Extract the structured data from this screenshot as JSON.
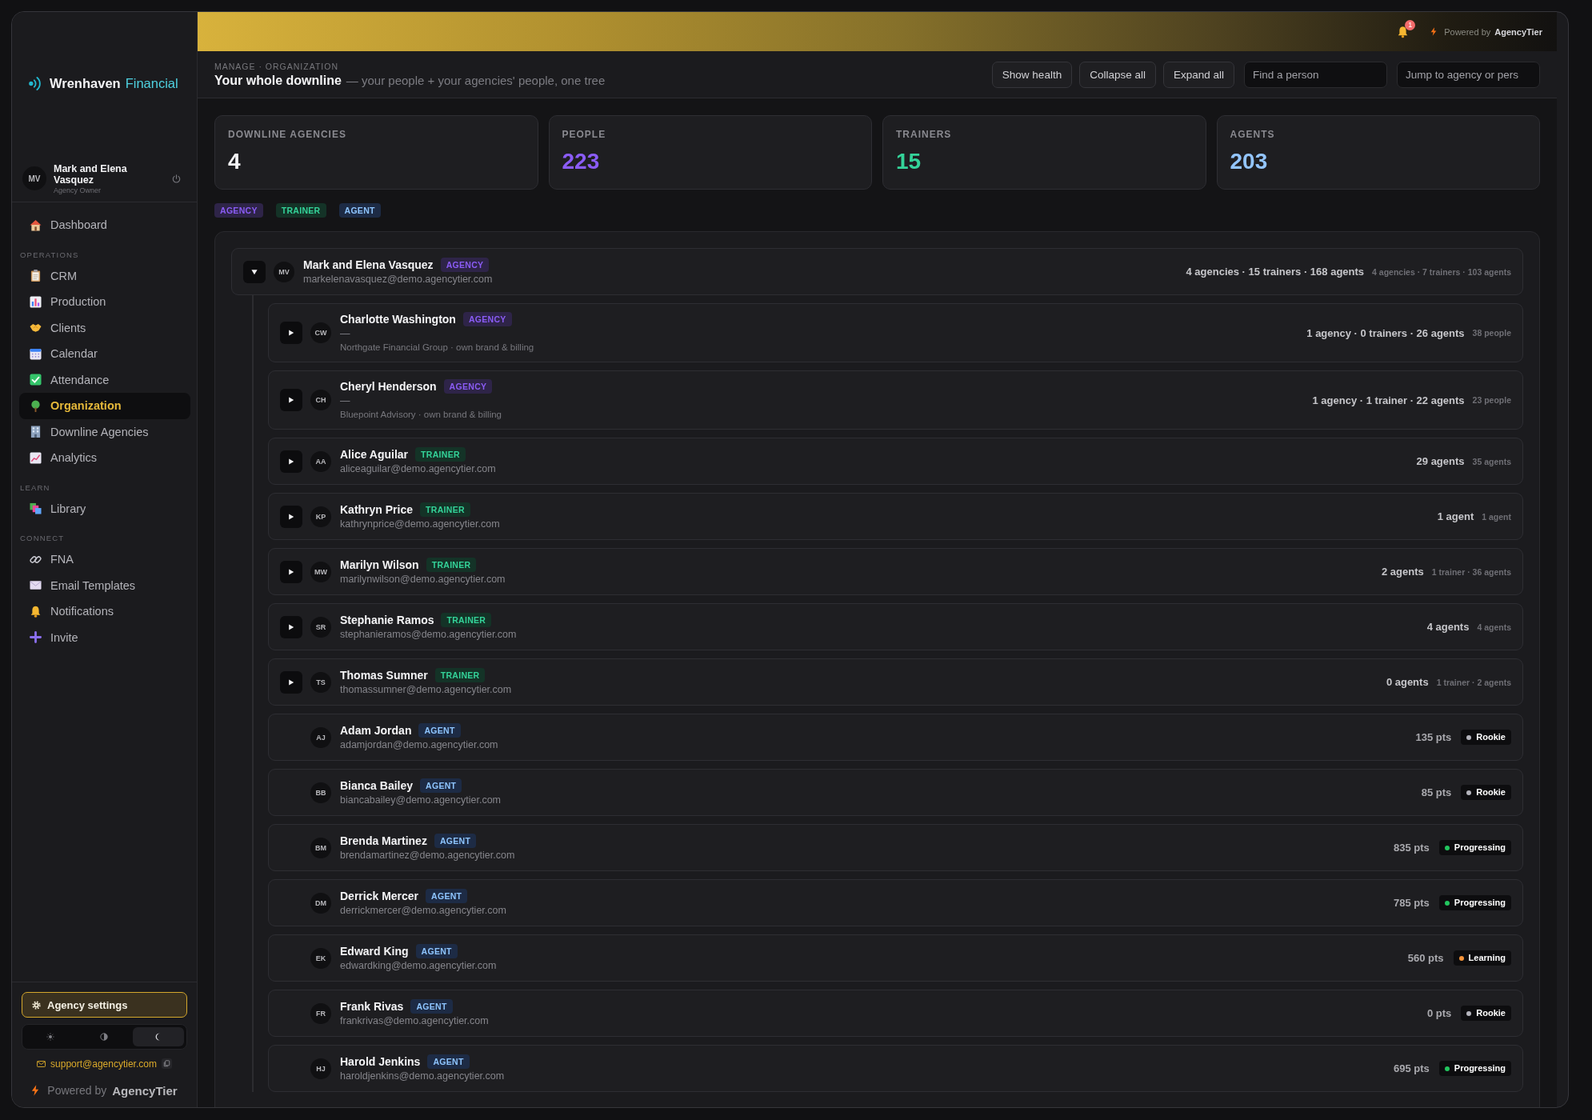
{
  "sidebar": {
    "brand": {
      "name": "Wrenhaven",
      "accent": "Financial"
    },
    "user": {
      "initials": "MV",
      "name": "Mark and Elena Vasquez",
      "role": "Agency Owner"
    },
    "nav_sections": [
      {
        "items": [
          {
            "label": "Dashboard",
            "selected": false
          }
        ]
      },
      {
        "heading": "OPERATIONS",
        "items": [
          {
            "label": "CRM",
            "selected": false
          },
          {
            "label": "Production",
            "selected": false
          },
          {
            "label": "Clients",
            "selected": false
          },
          {
            "label": "Calendar",
            "selected": false
          },
          {
            "label": "Attendance",
            "selected": false
          },
          {
            "label": "Organization",
            "selected": true
          },
          {
            "label": "Downline Agencies",
            "selected": false
          },
          {
            "label": "Analytics",
            "selected": false
          }
        ]
      },
      {
        "heading": "LEARN",
        "items": [
          {
            "label": "Library",
            "selected": false
          }
        ]
      },
      {
        "heading": "CONNECT",
        "items": [
          {
            "label": "FNA",
            "selected": false
          },
          {
            "label": "Email Templates",
            "selected": false
          },
          {
            "label": "Notifications",
            "selected": false
          },
          {
            "label": "Invite",
            "selected": false
          }
        ]
      }
    ],
    "settings_button": "Agency settings",
    "theme_options": [
      {
        "kind": "light",
        "selected": false
      },
      {
        "kind": "system",
        "selected": false
      },
      {
        "kind": "dark",
        "selected": true
      }
    ],
    "support_email": "support@agencytier.com",
    "powered_by": {
      "prefix": "Powered by",
      "brand": "AgencyTier"
    }
  },
  "top_bar": {
    "notification_count": "1",
    "powered_by": {
      "prefix": "Powered by",
      "brand": "AgencyTier"
    }
  },
  "header": {
    "breadcrumb": "MANAGE · ORGANIZATION",
    "title": "Your whole downline",
    "subtitle": "— your people + your agencies' people, one tree",
    "buttons": [
      "Show health",
      "Collapse all",
      "Expand all"
    ],
    "search_fields": [
      {
        "placeholder": "Find a person"
      },
      {
        "placeholder": "Jump to agency or pers"
      }
    ]
  },
  "stats": [
    {
      "label": "DOWNLINE AGENCIES",
      "value": "4",
      "color": "#f4f4f6"
    },
    {
      "label": "PEOPLE",
      "value": "223",
      "color": "#8b5cf6"
    },
    {
      "label": "TRAINERS",
      "value": "15",
      "color": "#34d399"
    },
    {
      "label": "AGENTS",
      "value": "203",
      "color": "#93c5fd"
    }
  ],
  "legend": [
    {
      "label": "AGENCY",
      "kind": "agency"
    },
    {
      "label": "TRAINER",
      "kind": "trainer"
    },
    {
      "label": "AGENT",
      "kind": "agent"
    }
  ],
  "tree": {
    "root": {
      "initials": "MV",
      "name": "Mark and Elena Vasquez",
      "kind": "agency",
      "badge": "AGENCY",
      "email": "markelenavasquez@demo.agencytier.com",
      "expanded": true,
      "summary": "4 agencies · 15 trainers · 168 agents",
      "summary_total": "4 agencies · 7 trainers · 103 agents",
      "children": [
        {
          "initials": "CW",
          "name": "Charlotte Washington",
          "kind": "agency",
          "badge": "AGENCY",
          "email": "—",
          "note": "Northgate Financial Group · own brand & billing",
          "expanded": false,
          "summary": "1 agency · 0 trainers · 26 agents",
          "summary_total": "38 people"
        },
        {
          "initials": "CH",
          "name": "Cheryl Henderson",
          "kind": "agency",
          "badge": "AGENCY",
          "email": "—",
          "note": "Bluepoint Advisory · own brand & billing",
          "expanded": false,
          "summary": "1 agency · 1 trainer · 22 agents",
          "summary_total": "23 people"
        },
        {
          "initials": "AA",
          "name": "Alice Aguilar",
          "kind": "trainer",
          "badge": "TRAINER",
          "email": "aliceaguilar@demo.agencytier.com",
          "expanded": false,
          "summary": "29 agents",
          "summary_total": "35 agents"
        },
        {
          "initials": "KP",
          "name": "Kathryn Price",
          "kind": "trainer",
          "badge": "TRAINER",
          "email": "kathrynprice@demo.agencytier.com",
          "expanded": false,
          "summary": "1 agent",
          "summary_total": "1 agent"
        },
        {
          "initials": "MW",
          "name": "Marilyn Wilson",
          "kind": "trainer",
          "badge": "TRAINER",
          "email": "marilynwilson@demo.agencytier.com",
          "expanded": false,
          "summary": "2 agents",
          "summary_total": "1 trainer · 36 agents"
        },
        {
          "initials": "SR",
          "name": "Stephanie Ramos",
          "kind": "trainer",
          "badge": "TRAINER",
          "email": "stephanieramos@demo.agencytier.com",
          "expanded": false,
          "summary": "4 agents",
          "summary_total": "4 agents"
        },
        {
          "initials": "TS",
          "name": "Thomas Sumner",
          "kind": "trainer",
          "badge": "TRAINER",
          "email": "thomassumner@demo.agencytier.com",
          "expanded": false,
          "summary": "0 agents",
          "summary_total": "1 trainer · 2 agents"
        },
        {
          "initials": "AJ",
          "name": "Adam Jordan",
          "kind": "agent",
          "badge": "AGENT",
          "email": "adamjordan@demo.agencytier.com",
          "points": "135 pts",
          "status": {
            "label": "Rookie",
            "color": "#b4b4bc"
          }
        },
        {
          "initials": "BB",
          "name": "Bianca Bailey",
          "kind": "agent",
          "badge": "AGENT",
          "email": "biancabailey@demo.agencytier.com",
          "points": "85 pts",
          "status": {
            "label": "Rookie",
            "color": "#b4b4bc"
          }
        },
        {
          "initials": "BM",
          "name": "Brenda Martinez",
          "kind": "agent",
          "badge": "AGENT",
          "email": "brendamartinez@demo.agencytier.com",
          "points": "835 pts",
          "status": {
            "label": "Progressing",
            "color": "#22c55e"
          }
        },
        {
          "initials": "DM",
          "name": "Derrick Mercer",
          "kind": "agent",
          "badge": "AGENT",
          "email": "derrickmercer@demo.agencytier.com",
          "points": "785 pts",
          "status": {
            "label": "Progressing",
            "color": "#22c55e"
          }
        },
        {
          "initials": "EK",
          "name": "Edward King",
          "kind": "agent",
          "badge": "AGENT",
          "email": "edwardking@demo.agencytier.com",
          "points": "560 pts",
          "status": {
            "label": "Learning",
            "color": "#f5943a"
          }
        },
        {
          "initials": "FR",
          "name": "Frank Rivas",
          "kind": "agent",
          "badge": "AGENT",
          "email": "frankrivas@demo.agencytier.com",
          "points": "0 pts",
          "status": {
            "label": "Rookie",
            "color": "#b4b4bc"
          }
        },
        {
          "initials": "HJ",
          "name": "Harold Jenkins",
          "kind": "agent",
          "badge": "AGENT",
          "email": "haroldjenkins@demo.agencytier.com",
          "points": "695 pts",
          "status": {
            "label": "Progressing",
            "color": "#22c55e"
          }
        }
      ]
    }
  }
}
